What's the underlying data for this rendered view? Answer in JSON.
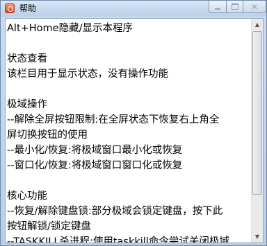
{
  "window": {
    "title": "帮助",
    "icon": "app-icon",
    "controls": {
      "minimize_icon": "minimize-icon",
      "maximize_icon": "maximize-icon",
      "close_icon": "close-icon"
    }
  },
  "content": {
    "lines": [
      "Alt+Home隐藏/显示本程序",
      "",
      "状态查看",
      "该栏目用于显示状态，没有操作功能",
      "",
      "极域操作",
      "--解除全屏按钮限制:在全屏状态下恢复右上角全",
      "屏切换按钮的使用",
      "--最小化/恢复:将极域窗口最小化或恢复",
      "--窗口化/恢复:将极域窗口窗口化或恢复",
      "",
      "核心功能",
      "--恢复/解除键盘锁:部分极域会锁定键盘，按下此",
      "按钮解锁/锁定键盘",
      "--TASKKILL杀进程:使用taskkill命令尝试关闭极域"
    ]
  },
  "colors": {
    "title_bar": "#c6d9ef",
    "icon_red": "#d9411b",
    "text": "#000000",
    "background": "#ffffff"
  }
}
